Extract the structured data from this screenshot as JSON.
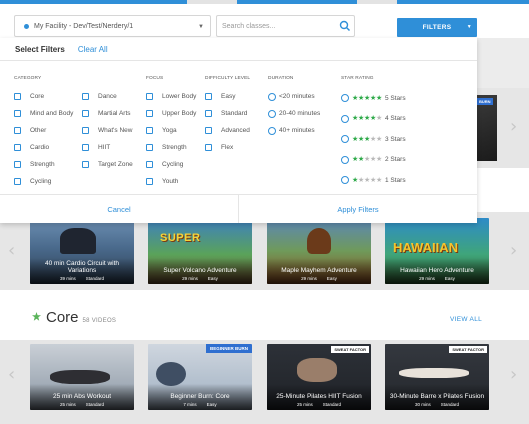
{
  "toolbar": {
    "facility_value": "My Facility - Dev/Test/Nerdery/1",
    "search_placeholder": "Search classes...",
    "filters_label": "FILTERS"
  },
  "filter_panel": {
    "title": "Select Filters",
    "clear_all": "Clear All",
    "category": {
      "header": "CATEGORY",
      "col1": [
        "Core",
        "Mind and Body",
        "Other",
        "Cardio",
        "Strength",
        "Cycling"
      ],
      "col2": [
        "Dance",
        "Martial Arts",
        "What's New",
        "HIIT",
        "Target Zone"
      ]
    },
    "focus": {
      "header": "FOCUS",
      "options": [
        "Lower Body",
        "Upper Body",
        "Yoga",
        "Strength",
        "Cycling",
        "Youth"
      ]
    },
    "difficulty": {
      "header": "DIFFICULTY LEVEL",
      "options": [
        "Easy",
        "Standard",
        "Advanced",
        "Flex"
      ]
    },
    "duration": {
      "header": "DURATION",
      "options": [
        "<20 minutes",
        "20-40 minutes",
        "40+ minutes"
      ]
    },
    "star_rating": {
      "header": "STAR RATING",
      "options": [
        {
          "label": "5 Stars",
          "stars": 5
        },
        {
          "label": "4 Stars",
          "stars": 4
        },
        {
          "label": "3 Stars",
          "stars": 3
        },
        {
          "label": "2 Stars",
          "stars": 2
        },
        {
          "label": "1 Stars",
          "stars": 1
        }
      ]
    },
    "cancel_label": "Cancel",
    "apply_label": "Apply Filters"
  },
  "row_one": {
    "videos": [
      {
        "title": "40 min Cardio Circuit with Variations",
        "duration": "39 mins",
        "level": "Standard"
      },
      {
        "title": "Super Volcano Adventure",
        "duration": "29 mins",
        "level": "Easy"
      },
      {
        "title": "Maple Mayhem Adventure",
        "duration": "29 mins",
        "level": "Easy"
      },
      {
        "title": "Hawaiian Hero Adventure",
        "duration": "29 mins",
        "level": "Easy"
      }
    ]
  },
  "core_section": {
    "title": "Core",
    "count": "58 VIDEOS",
    "view_all": "VIEW ALL",
    "videos": [
      {
        "title": "25 min Abs Workout",
        "duration": "25 mins",
        "level": "Standard",
        "badge": ""
      },
      {
        "title": "Beginner Burn: Core",
        "duration": "7 mins",
        "level": "Easy",
        "badge": "BEGINNER BURN"
      },
      {
        "title": "25-Minute Pilates HIIT Fusion",
        "duration": "25 mins",
        "level": "Standard",
        "badge": "SWEAT FACTOR"
      },
      {
        "title": "30-Minute Barre x Pilates Fusion",
        "duration": "30 mins",
        "level": "Standard",
        "badge": "SWEAT FACTOR"
      }
    ]
  },
  "colors": {
    "accent": "#2f8fd8",
    "star_on": "#2faa4a",
    "star_off": "#b9b9b9"
  }
}
